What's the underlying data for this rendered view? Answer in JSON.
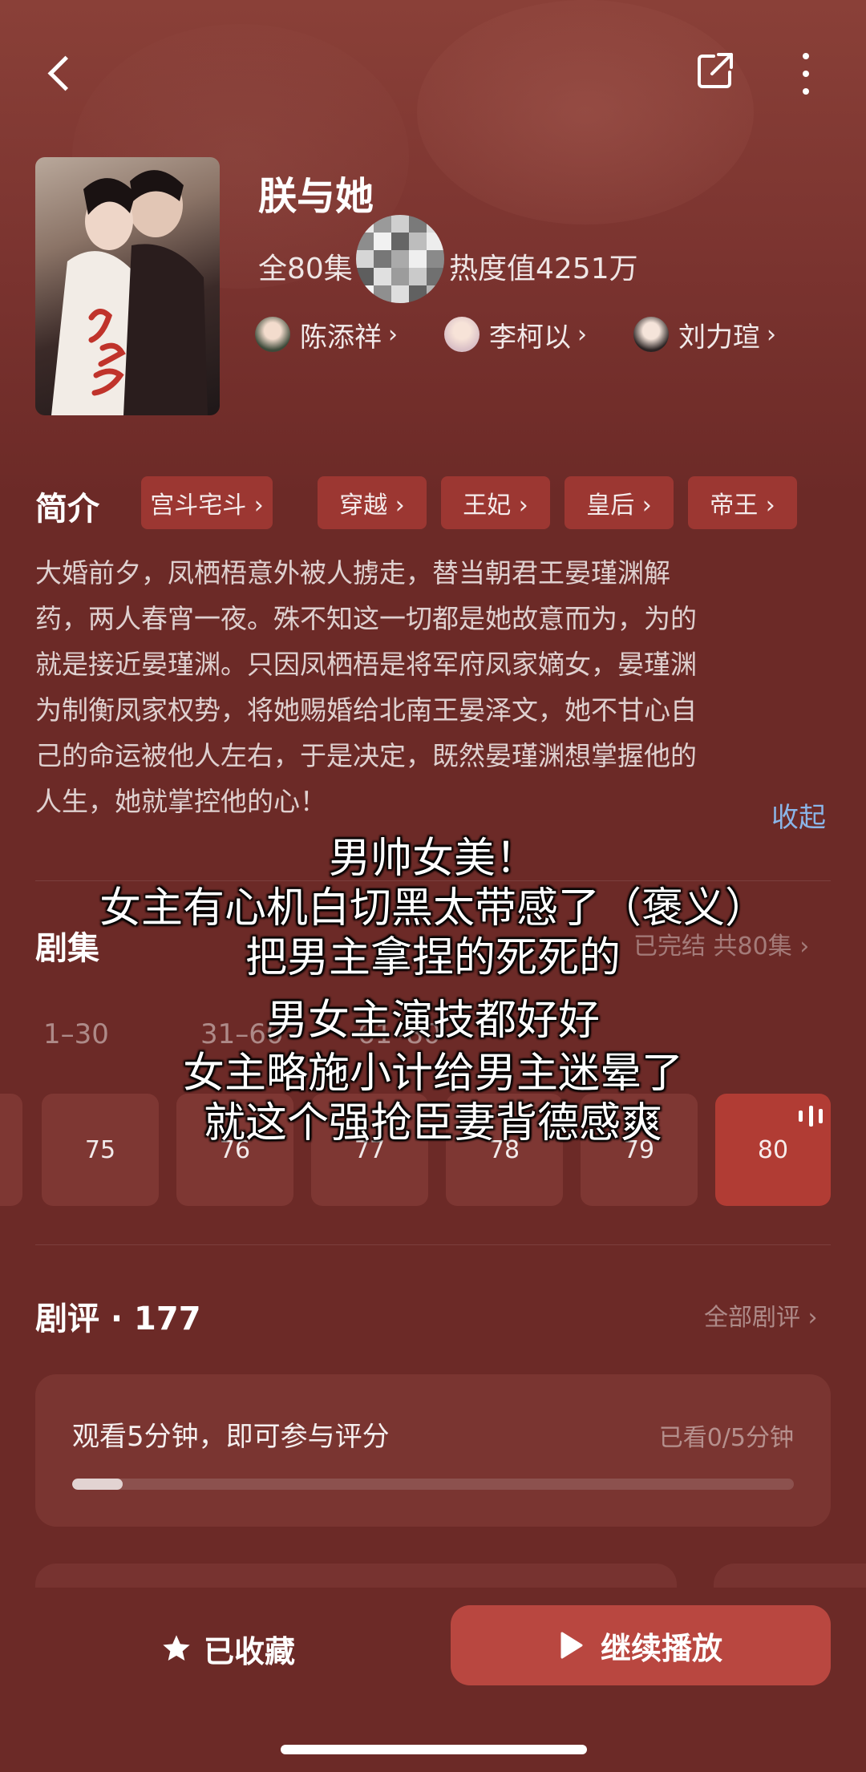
{
  "header": {
    "back_icon": "chevron-left-icon",
    "share_icon": "share-icon",
    "more_icon": "more-vertical-icon"
  },
  "drama": {
    "title": "朕与她",
    "episodes_total": "全80集",
    "heat": "热度值4251万",
    "cast": [
      {
        "name": "陈添祥",
        "chevron": "›"
      },
      {
        "name": "李柯以",
        "chevron": "›"
      },
      {
        "name": "刘力瑄",
        "chevron": "›"
      }
    ]
  },
  "intro": {
    "label": "简介",
    "tags": [
      "宫斗宅斗 ›",
      "穿越 ›",
      "王妃 ›",
      "皇后 ›",
      "帝王 ›"
    ],
    "synopsis_lines": [
      "大婚前夕，凤栖梧意外被人掳走，替当朝君王晏瑾渊解",
      "药，两人春宵一夜。殊不知这一切都是她故意而为，为的",
      "就是接近晏瑾渊。只因凤栖梧是将军府凤家嫡女，晏瑾渊",
      "为制衡凤家权势，将她赐婚给北南王晏泽文，她不甘心自",
      "己的命运被他人左右，于是决定，既然晏瑾渊想掌握他的",
      "人生，她就掌控他的心！"
    ],
    "collapse": "收起"
  },
  "episodes": {
    "label": "剧集",
    "status": "已完结 共80集 ›",
    "ranges": [
      "1–30",
      "31–60",
      "61–80"
    ],
    "tiles": [
      "75",
      "76",
      "77",
      "78",
      "79",
      "80"
    ],
    "current": "80"
  },
  "reviews": {
    "title": "剧评 · 177",
    "all_link": "全部剧评 ›",
    "prompt": "观看5分钟，即可参与评分",
    "watched": "已看0/5分钟",
    "progress_fraction": 0.07
  },
  "actions": {
    "favorite_icon": "star-icon",
    "favorite_label": "已收藏",
    "play_icon": "play-icon",
    "play_label": "继续播放"
  },
  "caption_lines": [
    "男帅女美！",
    "女主有心机白切黑太带感了（褒义）",
    "把男主拿捏的死死的",
    "男女主演技都好好",
    "女主略施小计给男主迷晕了",
    "就这个强抢臣妻背德感爽"
  ],
  "colors": {
    "background": "#6c2a27",
    "tag_bg": "#9c3732",
    "active_tile": "#b13c34",
    "play_button": "#b94740",
    "link_blue": "#8ab5e8"
  }
}
